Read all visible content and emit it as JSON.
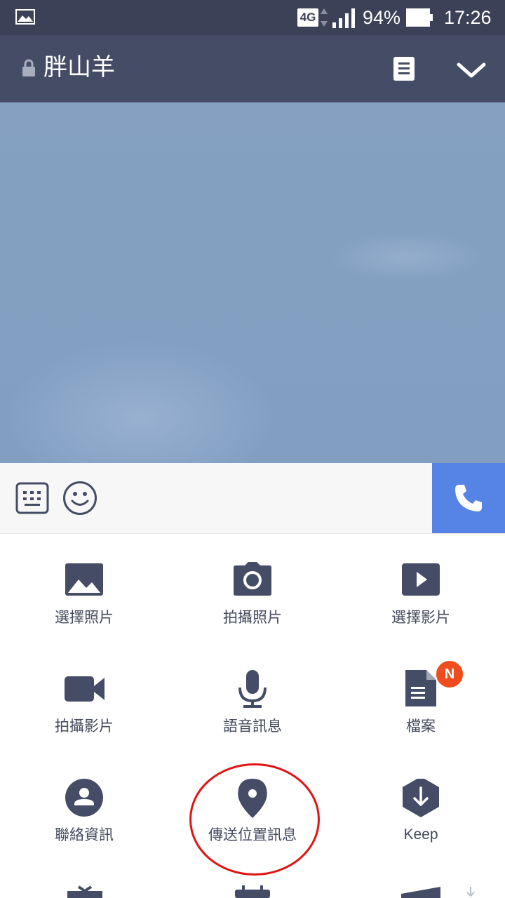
{
  "status_bar": {
    "network": "4G",
    "battery_percent": "94%",
    "time": "17:26",
    "icons": [
      "gallery-icon",
      "data-arrows-icon",
      "signal-icon",
      "battery-icon"
    ]
  },
  "header": {
    "title": "胖山羊",
    "icons": [
      "lock-icon",
      "notes-icon",
      "chevron-down-icon"
    ]
  },
  "input_bar": {
    "icons": [
      "keyboard-icon",
      "emoji-icon",
      "phone-icon"
    ]
  },
  "menu": {
    "items": [
      {
        "label": "選擇照片",
        "icon": "image-icon"
      },
      {
        "label": "拍攝照片",
        "icon": "camera-icon"
      },
      {
        "label": "選擇影片",
        "icon": "video-play-icon"
      },
      {
        "label": "拍攝影片",
        "icon": "video-camera-icon"
      },
      {
        "label": "語音訊息",
        "icon": "microphone-icon"
      },
      {
        "label": "檔案",
        "icon": "file-icon",
        "badge": "N"
      },
      {
        "label": "聯絡資訊",
        "icon": "contact-icon"
      },
      {
        "label": "傳送位置訊息",
        "icon": "location-pin-icon"
      },
      {
        "label": "Keep",
        "icon": "keep-icon"
      }
    ]
  },
  "colors": {
    "status_bar": "#3b4157",
    "header": "#454c66",
    "chat_background": "#829fc2",
    "call_button": "#5683e6",
    "icon": "#454c66",
    "badge": "#f04d1e",
    "highlight_circle": "#e11414"
  }
}
